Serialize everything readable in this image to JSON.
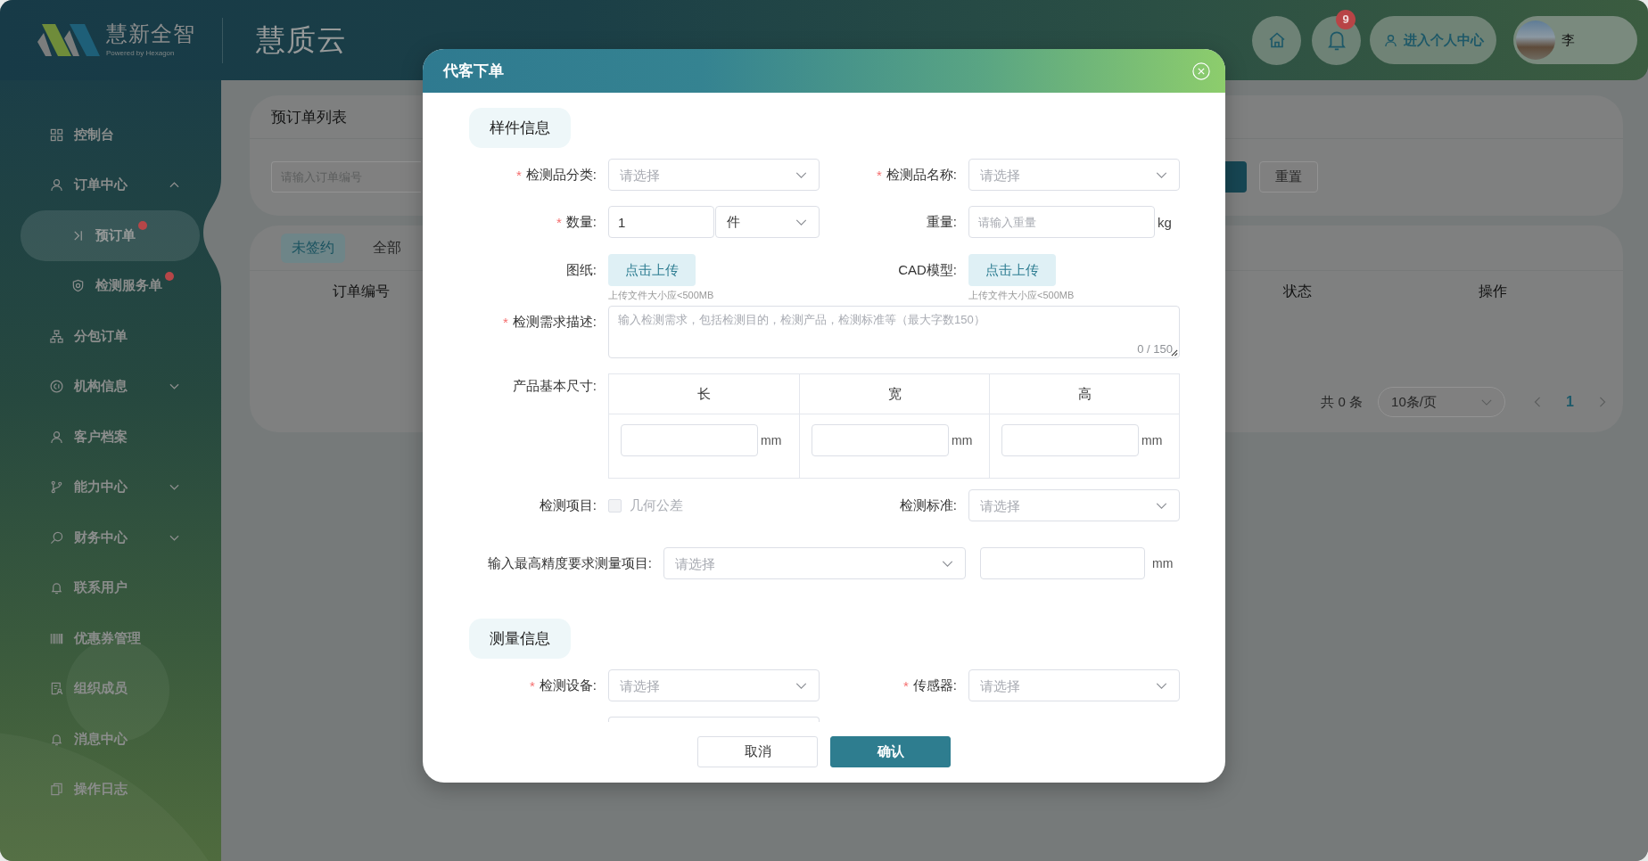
{
  "header": {
    "brand": "慧新全智",
    "tagline": "Powered by Hexagon",
    "app_title": "慧质云",
    "notification_count": "9",
    "profile_button": "进入个人中心",
    "user_name": "李"
  },
  "sidebar": {
    "items": [
      {
        "label": "控制台",
        "kind": "link",
        "selected": false
      },
      {
        "label": "订单中心",
        "kind": "group",
        "expanded": true,
        "selected": false,
        "children": [
          {
            "label": "预订单",
            "selected": true,
            "alert": true
          },
          {
            "label": "检测服务单",
            "selected": false,
            "alert": true
          }
        ]
      },
      {
        "label": "分包订单",
        "kind": "link",
        "selected": false
      },
      {
        "label": "机构信息",
        "kind": "group",
        "expanded": false,
        "selected": false
      },
      {
        "label": "客户档案",
        "kind": "link",
        "selected": false
      },
      {
        "label": "能力中心",
        "kind": "group",
        "expanded": false,
        "selected": false
      },
      {
        "label": "财务中心",
        "kind": "group",
        "expanded": false,
        "selected": false
      },
      {
        "label": "联系用户",
        "kind": "link",
        "selected": false
      },
      {
        "label": "优惠券管理",
        "kind": "link",
        "selected": false
      },
      {
        "label": "组织成员",
        "kind": "link",
        "selected": false
      },
      {
        "label": "消息中心",
        "kind": "link",
        "selected": false
      },
      {
        "label": "操作日志",
        "kind": "link",
        "selected": false
      }
    ]
  },
  "filter_card": {
    "title": "预订单列表",
    "search": {
      "placeholder": "请输入订单编号"
    },
    "reset_button": "重置"
  },
  "table_card": {
    "tabs": [
      {
        "label": "未签约",
        "selected": true
      },
      {
        "label": "全部",
        "selected": false
      }
    ],
    "columns": [
      "订单编号",
      "状态",
      "操作"
    ],
    "pagination": {
      "total": "共 0 条",
      "page_size": "10条/页",
      "pages": [
        {
          "label": "1",
          "selected": true
        }
      ]
    }
  },
  "dialog": {
    "title": "代客下单",
    "sections": [
      {
        "title": "样件信息",
        "fields": [
          {
            "kind": "select",
            "required_mark": "*",
            "label": "检测品分类:",
            "placeholder": "请选择"
          },
          {
            "kind": "select",
            "required_mark": "*",
            "label": "检测品名称:",
            "placeholder": "请选择"
          },
          {
            "kind": "quantity",
            "required_mark": "*",
            "label": "数量:",
            "value": "1",
            "unit": "件"
          },
          {
            "kind": "input",
            "label": "重量:",
            "placeholder": "请输入重量",
            "unit": "kg"
          },
          {
            "kind": "upload",
            "label": "图纸:",
            "button": "点击上传",
            "hint": "上传文件大小应<500MB"
          },
          {
            "kind": "upload",
            "label": "CAD模型:",
            "button": "点击上传",
            "hint": "上传文件大小应<500MB"
          },
          {
            "kind": "textarea",
            "required_mark": "*",
            "label": "检测需求描述:",
            "placeholder": "输入检测需求，包括检测目的，检测产品，检测标准等（最大字数150）",
            "counter": "0 / 150"
          },
          {
            "kind": "dimensions",
            "label": "产品基本尺寸:",
            "columns": [
              {
                "heading": "长",
                "unit": "mm"
              },
              {
                "heading": "宽",
                "unit": "mm"
              },
              {
                "heading": "高",
                "unit": "mm"
              }
            ]
          },
          {
            "kind": "checkboxes",
            "label": "检测项目:",
            "options": [
              {
                "label": "几何公差",
                "checked": false,
                "disabled": true
              }
            ]
          },
          {
            "kind": "select",
            "label": "检测标准:",
            "placeholder": "请选择"
          },
          {
            "kind": "precision",
            "label": "输入最高精度要求测量项目:",
            "placeholder": "请选择",
            "unit": "mm"
          }
        ]
      },
      {
        "title": "测量信息",
        "fields": [
          {
            "kind": "select",
            "required_mark": "*",
            "label": "检测设备:",
            "placeholder": "请选择"
          },
          {
            "kind": "select",
            "required_mark": "*",
            "label": "传感器:",
            "placeholder": "请选择"
          },
          {
            "kind": "cut_off"
          }
        ]
      }
    ],
    "buttons": [
      {
        "label": "取消",
        "kind": "secondary"
      },
      {
        "label": "确认",
        "kind": "primary"
      }
    ]
  }
}
